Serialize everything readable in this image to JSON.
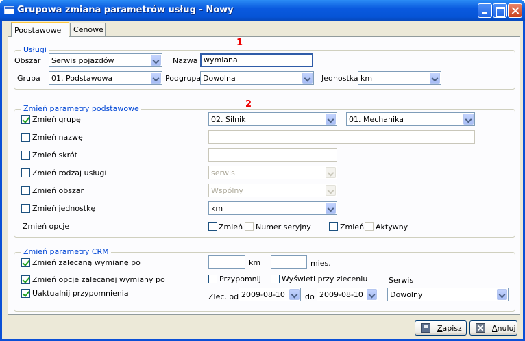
{
  "window": {
    "title": "Grupowa zmiana parametrów usług - Nowy"
  },
  "tabs": [
    {
      "label": "Podstawowe",
      "active": true
    },
    {
      "label": "Cenowe",
      "active": false
    }
  ],
  "markers": [
    "1",
    "2"
  ],
  "uslugi": {
    "legend": "Usługi",
    "obszar_label": "Obszar",
    "obszar_value": "Serwis pojazdów",
    "nazwa_label": "Nazwa",
    "nazwa_value": "wymiana",
    "grupa_label": "Grupa",
    "grupa_value": "01. Podstawowa",
    "podgrupa_label": "Podgrupa",
    "podgrupa_value": "Dowolna",
    "jednostka_label": "Jednostka",
    "jednostka_value": "km"
  },
  "podstawowe": {
    "legend": "Zmień parametry podstawowe",
    "zmien_grupe": {
      "label": "Zmień grupę",
      "checked": true,
      "grupa": "02. Silnik",
      "podgrupa": "01. Mechanika"
    },
    "zmien_nazwe": {
      "label": "Zmień nazwę",
      "checked": false,
      "value": ""
    },
    "zmien_skrot": {
      "label": "Zmień skrót",
      "checked": false,
      "value": ""
    },
    "zmien_rodzaj": {
      "label": "Zmień rodzaj usługi",
      "checked": false,
      "value": "serwis"
    },
    "zmien_obszar": {
      "label": "Zmień obszar",
      "checked": false,
      "value": "Wspólny"
    },
    "zmien_jednostke": {
      "label": "Zmień jednostkę",
      "checked": false,
      "value": "km"
    },
    "opcje": {
      "label": "Zmień opcje",
      "zmien1": "Zmień",
      "numer_seryjny": "Numer seryjny",
      "zmien2": "Zmień",
      "aktywny": "Aktywny"
    }
  },
  "crm": {
    "legend": "Zmień parametry CRM",
    "zalecana": {
      "label": "Zmień zalecaną wymianę po",
      "checked": true,
      "km": "",
      "km_unit": "km",
      "mies": "",
      "mies_unit": "mies."
    },
    "opcje_zalecanej": {
      "label": "Zmień opcje zalecanej wymiany po",
      "checked": true,
      "przypomnij": "Przypomnij",
      "wyswietl": "Wyświetl przy zleceniu"
    },
    "uaktualnij": {
      "label": "Uaktualnij przypomnienia",
      "checked": true,
      "zlec_od_label": "Zlec. od",
      "zlec_od": "2009-08-10",
      "do_label": "do",
      "do": "2009-08-10"
    },
    "serwis_label": "Serwis",
    "serwis_value": "Dowolny"
  },
  "buttons": {
    "save_prefix": "",
    "save_u": "Z",
    "save_rest": "apisz",
    "cancel_u": "A",
    "cancel_rest": "nuluj"
  }
}
